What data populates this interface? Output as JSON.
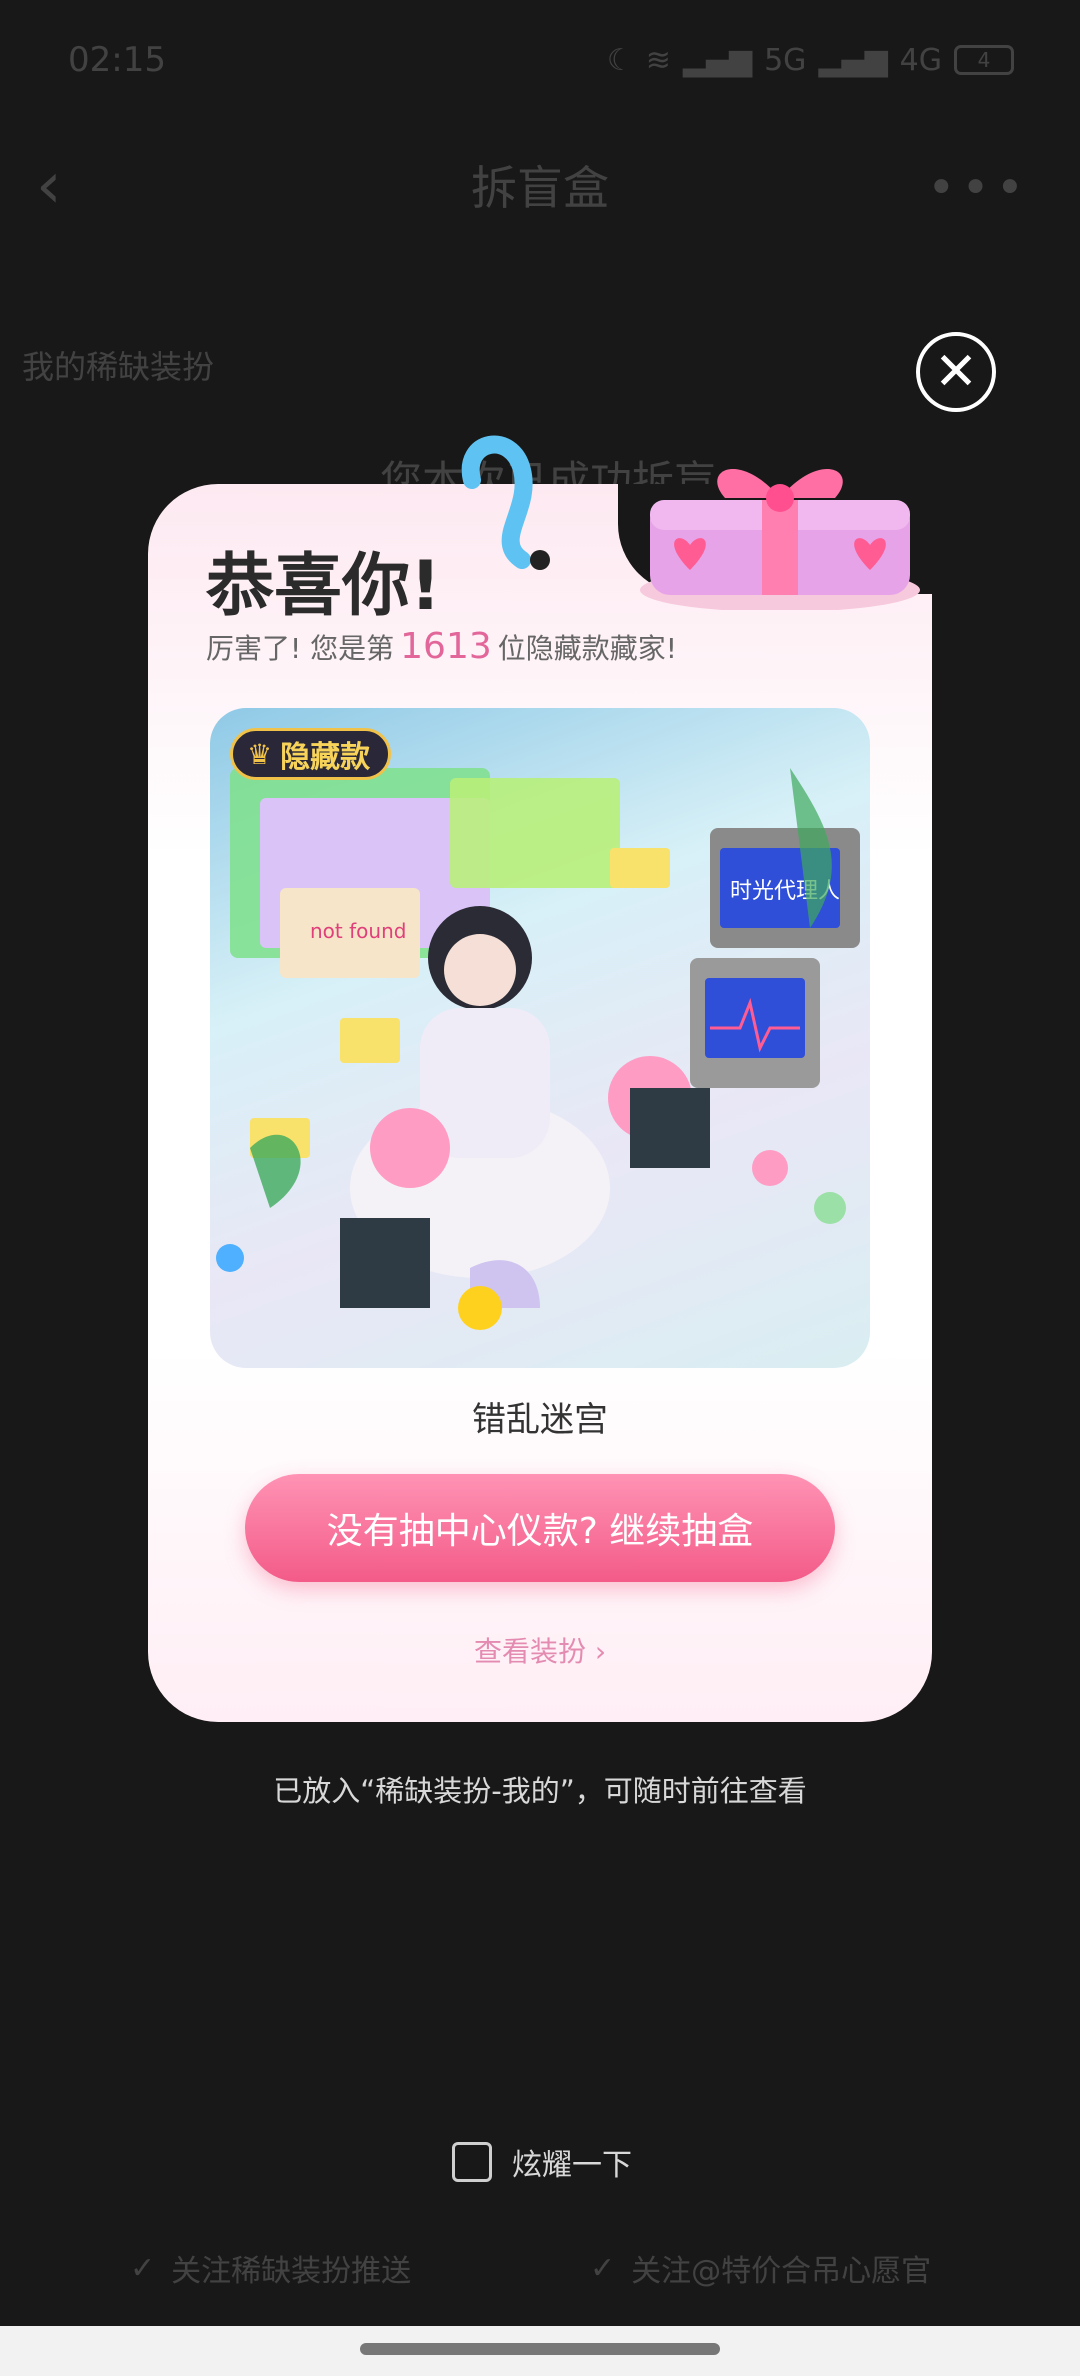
{
  "status_bar": {
    "time": "02:15",
    "net_1": "5G",
    "net_2": "4G",
    "battery": "4"
  },
  "nav": {
    "title": "拆盲盒"
  },
  "background": {
    "section_title": "我的稀缺装扮",
    "heading": "您本次已成功拆盲",
    "follow_1": "关注稀缺装扮推送",
    "follow_2": "关注@特价合吊心愿官"
  },
  "modal": {
    "title": "恭喜你!",
    "subtitle_prefix": "厉害了!  您是第",
    "rank": "1613",
    "subtitle_suffix": "位隐藏款藏家!",
    "badge": "隐藏款",
    "item_name": "错乱迷宫",
    "cta": "没有抽中心仪款?  继续抽盒",
    "view_link": "查看装扮",
    "artwork_sign": "时光代理人",
    "artwork_popup": "not found"
  },
  "info_text": "已放入“稀缺装扮-我的”，可随时前往查看",
  "show_off": {
    "label": "炫耀一下",
    "checked": false
  },
  "colors": {
    "accent": "#f35b88",
    "rank": "#e2669a",
    "link": "#e48bb1",
    "badge_gold": "#f1c24a"
  }
}
